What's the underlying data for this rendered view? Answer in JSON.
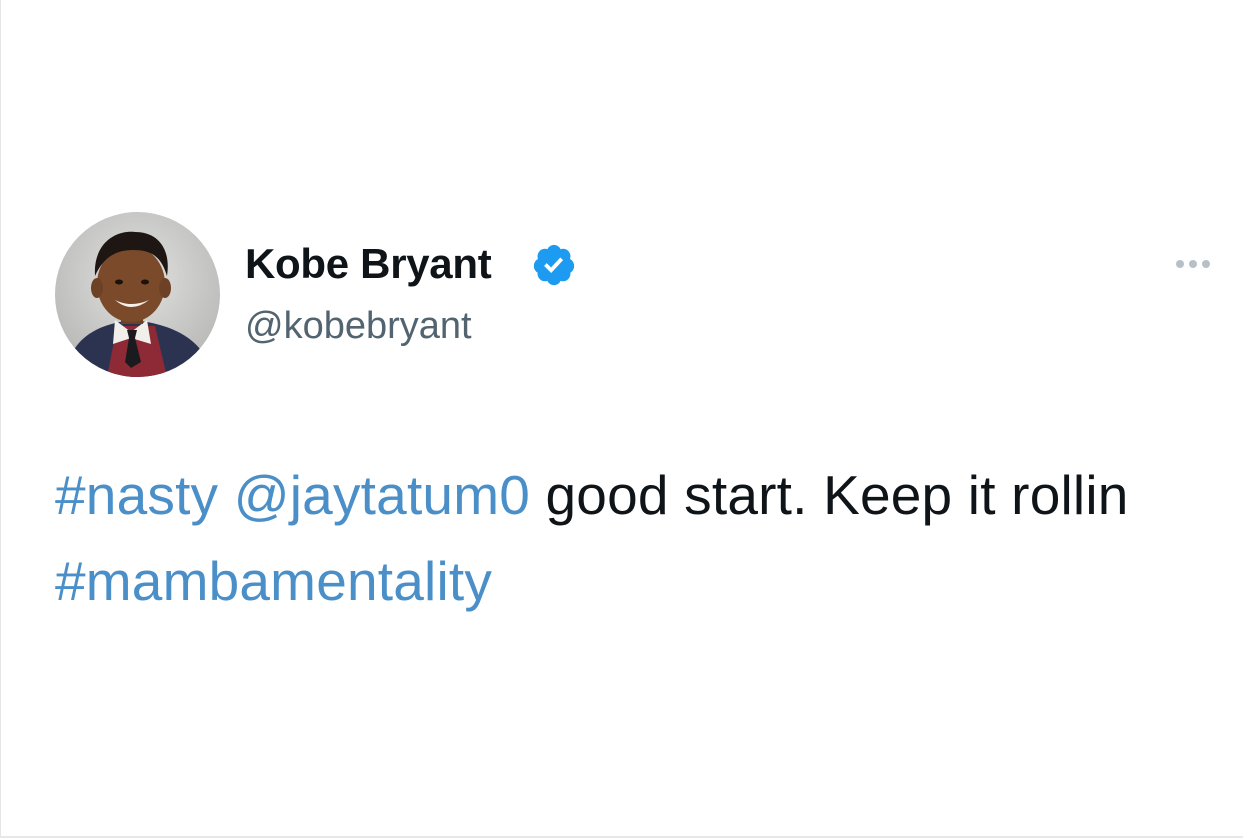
{
  "author": {
    "display_name": "Kobe Bryant",
    "handle": "@kobebryant",
    "verified": true,
    "avatar": "avatar-photo"
  },
  "actions": {
    "more_icon": "more-horizontal-icon"
  },
  "tweet": {
    "segments": [
      {
        "type": "hashtag",
        "text": "#nasty"
      },
      {
        "type": "text",
        "text": " "
      },
      {
        "type": "mention",
        "text": "@jaytatum0"
      },
      {
        "type": "text",
        "text": " good start. Keep it rollin "
      },
      {
        "type": "hashtag",
        "text": "#mambamentality"
      }
    ]
  },
  "colors": {
    "link": "#4a8fc8",
    "verified": "#1d9bf0",
    "text": "#0f1419",
    "secondary": "#536471"
  }
}
